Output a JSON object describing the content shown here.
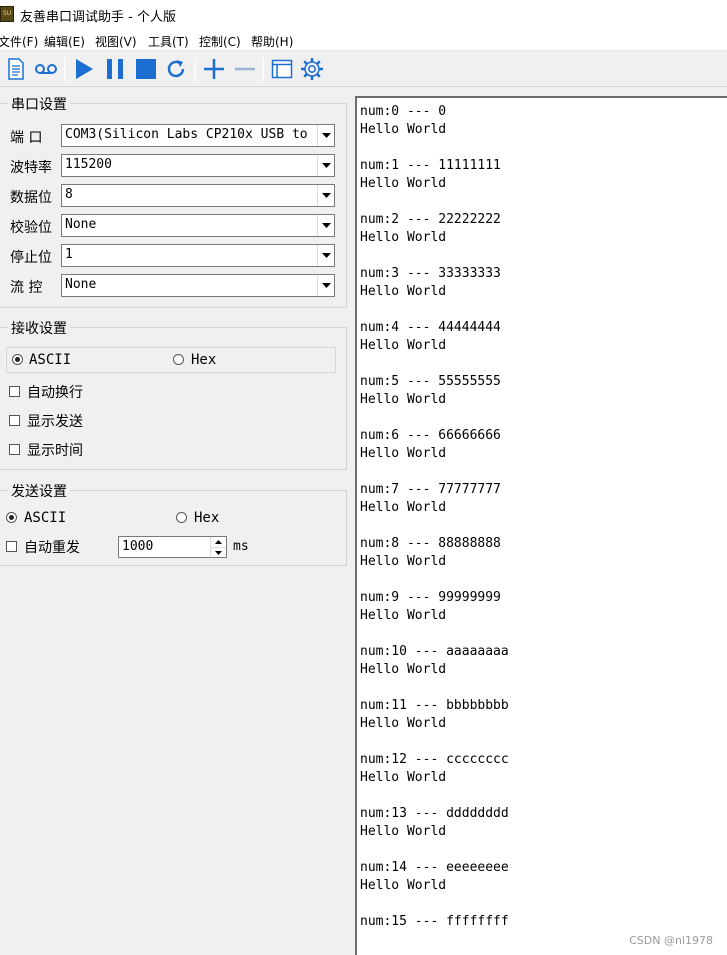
{
  "window": {
    "title": "友善串口调试助手 - 个人版",
    "icon_text": "SU"
  },
  "menu": {
    "file": "文件(F)",
    "edit": "编辑(E)",
    "view": "视图(V)",
    "tools": "工具(T)",
    "control": "控制(C)",
    "help": "帮助(H)"
  },
  "toolbar": {
    "buttons": [
      "new-document-icon",
      "record-icon",
      "play-icon",
      "pause-icon",
      "stop-icon",
      "refresh-icon",
      "add-icon",
      "remove-icon",
      "window-icon",
      "settings-gear-icon"
    ],
    "accent": "#1c6fd1"
  },
  "serial_settings": {
    "title": "串口设置",
    "port": {
      "label": "端 口",
      "value": "COM3(Silicon Labs CP210x USB to"
    },
    "baud": {
      "label": "波特率",
      "value": "115200"
    },
    "data_bits": {
      "label": "数据位",
      "value": "8"
    },
    "parity": {
      "label": "校验位",
      "value": "None"
    },
    "stop_bits": {
      "label": "停止位",
      "value": "1"
    },
    "flow": {
      "label": "流 控",
      "value": "None"
    }
  },
  "receive_settings": {
    "title": "接收设置",
    "ascii": "ASCII",
    "hex": "Hex",
    "selected": "ASCII",
    "auto_wrap": {
      "label": "自动换行",
      "checked": false
    },
    "show_send": {
      "label": "显示发送",
      "checked": false
    },
    "show_time": {
      "label": "显示时间",
      "checked": false
    }
  },
  "send_settings": {
    "title": "发送设置",
    "ascii": "ASCII",
    "hex": "Hex",
    "selected": "ASCII",
    "auto_resend": {
      "label": "自动重发",
      "checked": false
    },
    "interval": "1000",
    "unit": "ms"
  },
  "receive_log": [
    {
      "num": "num:0 --- 0",
      "msg": "Hello World"
    },
    {
      "num": "num:1 --- 11111111",
      "msg": "Hello World"
    },
    {
      "num": "num:2 --- 22222222",
      "msg": "Hello World"
    },
    {
      "num": "num:3 --- 33333333",
      "msg": "Hello World"
    },
    {
      "num": "num:4 --- 44444444",
      "msg": "Hello World"
    },
    {
      "num": "num:5 --- 55555555",
      "msg": "Hello World"
    },
    {
      "num": "num:6 --- 66666666",
      "msg": "Hello World"
    },
    {
      "num": "num:7 --- 77777777",
      "msg": "Hello World"
    },
    {
      "num": "num:8 --- 88888888",
      "msg": "Hello World"
    },
    {
      "num": "num:9 --- 99999999",
      "msg": "Hello World"
    },
    {
      "num": "num:10 --- aaaaaaaa",
      "msg": "Hello World"
    },
    {
      "num": "num:11 --- bbbbbbbb",
      "msg": "Hello World"
    },
    {
      "num": "num:12 --- cccccccc",
      "msg": "Hello World"
    },
    {
      "num": "num:13 --- dddddddd",
      "msg": "Hello World"
    },
    {
      "num": "num:14 --- eeeeeeee",
      "msg": "Hello World"
    },
    {
      "num": "num:15 --- ffffffff",
      "msg": ""
    }
  ],
  "watermark": "CSDN @ni1978"
}
